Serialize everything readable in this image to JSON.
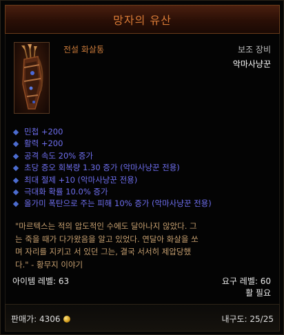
{
  "item": {
    "name": "망자의 유산",
    "type": "전설 화살통",
    "slot": "보조 장비",
    "class_requirement": "악마사냥꾼",
    "icon": "quiver-icon"
  },
  "stats": [
    "민첩 +200",
    "활력 +200",
    "공격 속도 20% 증가",
    "초당 증오 회복량 1.30 증가 (악마사냥꾼 전용)",
    "최대 절제 +10 (악마사냥꾼 전용)",
    "극대화 확률 10.0% 증가",
    "올가미 폭탄으로 주는 피해 10% 증가 (악마사냥꾼 전용)"
  ],
  "flavor_lines": [
    "\"마르텍스는 적의 압도적인 수에도 달아나지 않았다. 그",
    "는 죽을 때가 다가왔음을 알고 있었다. 연달아 화살을 쏘",
    "며 자리를 지키고 서 있던 그는, 결국 서서히 제압당했",
    "다.\" - 황무지 이야기"
  ],
  "requirements": {
    "item_level": "아이템 레벨: 63",
    "required_level": "요구 레벨: 60",
    "required_weapon": "활 필요"
  },
  "footer": {
    "sell_price": "판매가: 4306",
    "durability": "내구도: 25/25",
    "currency_icon": "gold-coin-icon"
  },
  "colors": {
    "title": "#d87a36",
    "item_type": "#c97a3a",
    "magic_stat": "#6f6ff0",
    "flavor": "#c7a070"
  }
}
